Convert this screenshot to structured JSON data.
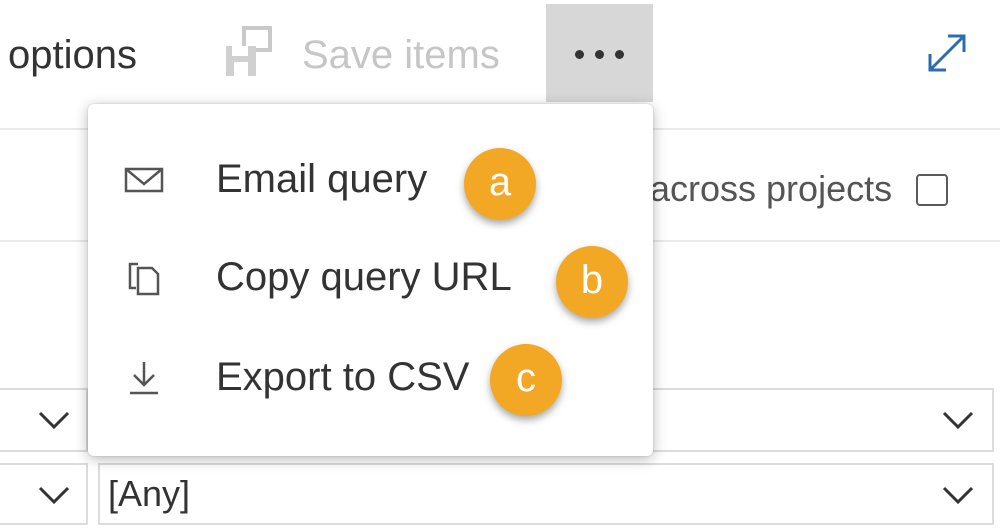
{
  "toolbar": {
    "options_label": "options",
    "save_label": "Save items"
  },
  "filters": {
    "across_projects_label": "across projects",
    "area_value": "[Any]"
  },
  "menu": {
    "items": [
      {
        "label": "Email query",
        "icon": "email-icon",
        "badge": "a"
      },
      {
        "label": "Copy query URL",
        "icon": "copy-icon",
        "badge": "b"
      },
      {
        "label": "Export to CSV",
        "icon": "download-icon",
        "badge": "c"
      }
    ]
  },
  "colors": {
    "badge": "#f2a825",
    "more_button_active": "#d7d7d7",
    "disabled_text": "#c6c6c6"
  }
}
